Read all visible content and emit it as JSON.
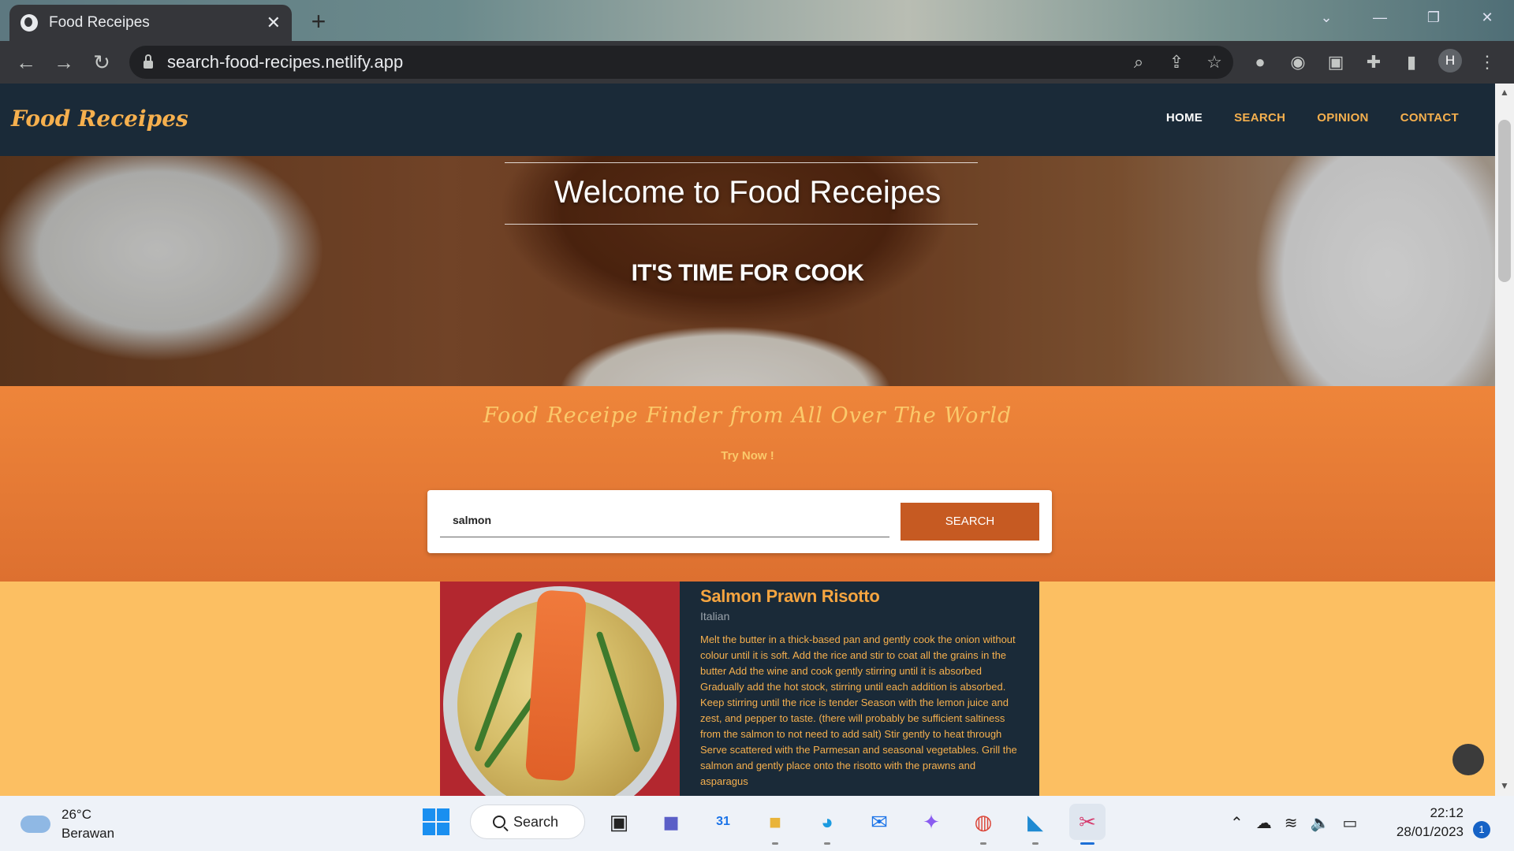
{
  "browser": {
    "tab_title": "Food Receipes",
    "tab_close": "✕",
    "new_tab": "+",
    "url": "search-food-recipes.netlify.app",
    "profile_initial": "H",
    "window_controls": {
      "minimize": "—",
      "restore": "❐",
      "close": "✕"
    },
    "nav": {
      "back": "←",
      "forward": "→",
      "reload": "↻"
    }
  },
  "site": {
    "brand": "Food Receipes",
    "menu": [
      {
        "label": "HOME"
      },
      {
        "label": "SEARCH"
      },
      {
        "label": "OPINION"
      },
      {
        "label": "CONTACT"
      }
    ],
    "hero": {
      "title": "Welcome to Food Receipes",
      "subtitle": "IT'S TIME FOR COOK"
    },
    "finder": {
      "heading": "Food Receipe Finder from All Over The World",
      "cta": "Try Now !",
      "search_value": "salmon",
      "search_button": "SEARCH"
    },
    "result": {
      "title": "Salmon Prawn Risotto",
      "cuisine": "Italian",
      "description": "Melt the butter in a thick-based pan and gently cook the onion without colour until it is soft. Add the rice and stir to coat all the grains in the butter Add the wine and cook gently stirring until it is absorbed Gradually add the hot stock, stirring until each addition is absorbed. Keep stirring until the rice is tender Season with the lemon juice and zest, and pepper to taste. (there will probably be sufficient saltiness from the salmon to not need to add salt) Stir gently to heat through Serve scattered with the Parmesan and seasonal vegetables. Grill the salmon and gently place onto the risotto with the prawns and asparagus"
    }
  },
  "taskbar": {
    "weather_temp": "26°C",
    "weather_desc": "Berawan",
    "search_label": "Search",
    "time": "22:12",
    "date": "28/01/2023",
    "notification_count": "1",
    "calendar_day": "31"
  },
  "colors": {
    "nav_bg": "#1a2a38",
    "accent": "#f6b04e",
    "finder_bg": "#ee853a",
    "page_bg": "#fcbf62",
    "search_button": "#c65a22"
  }
}
